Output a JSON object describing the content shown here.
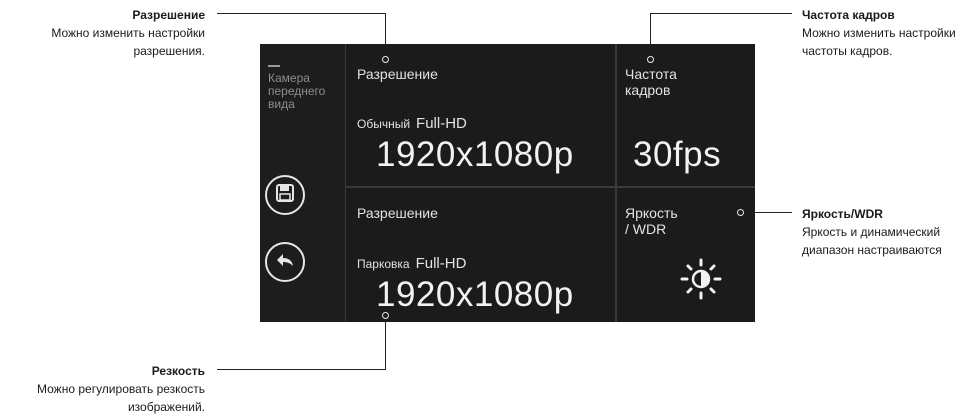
{
  "callouts": {
    "resolution": {
      "title": "Разрешение",
      "desc_line1": "Можно изменить настройки",
      "desc_line2": "разрешения."
    },
    "frame_rate": {
      "title": "Частота кадров",
      "desc_line1": "Можно изменить настройки",
      "desc_line2": "частоты кадров."
    },
    "brightness": {
      "title": "Яркость/WDR",
      "desc_line1": "Яркость и динамический",
      "desc_line2": "диапазон настраиваются"
    },
    "sharpness": {
      "title": "Резкость",
      "desc_line1": "Можно регулировать резкость",
      "desc_line2": "изображений."
    }
  },
  "screen": {
    "sidebar": {
      "camera_label": "Камера переднего вида",
      "save_icon": "save-icon",
      "back_icon": "back-arrow-icon"
    },
    "cells": {
      "normal_resolution": {
        "label": "Разрешение",
        "mode": "Обычный",
        "quality": "Full-HD",
        "value": "1920x1080p"
      },
      "frame_rate": {
        "label_line1": "Частота",
        "label_line2": "кадров",
        "value": "30fps"
      },
      "parking_resolution": {
        "label": "Разрешение",
        "mode": "Парковка",
        "quality": "Full-HD",
        "value": "1920x1080p"
      },
      "brightness": {
        "label_line1": "Яркость",
        "label_line2": "/ WDR",
        "icon": "brightness-icon"
      }
    }
  }
}
